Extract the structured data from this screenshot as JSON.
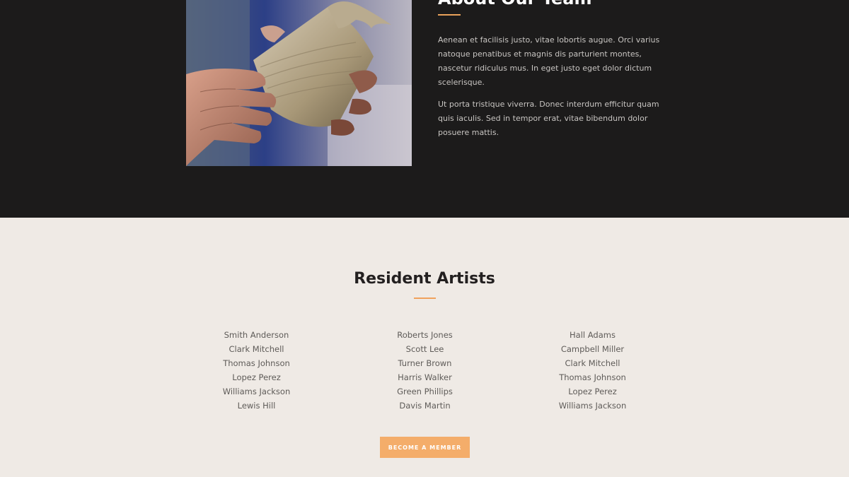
{
  "about": {
    "heading": "About Our Team",
    "paragraph_1": "Aenean et facilisis justo, vitae lobortis augue. Orci varius natoque penatibus et magnis dis parturient montes, nascetur ridiculus mus. In eget justo eget dolor dictum scelerisque.",
    "paragraph_2": "Ut porta tristique viverra. Donec interdum efficitur quam quis iaculis. Sed in tempor erat, vitae bibendum dolor posuere mattis.",
    "accent_color": "#e8a15a"
  },
  "artists": {
    "title": "Resident Artists",
    "columns": [
      [
        "Smith Anderson",
        "Clark Mitchell",
        "Thomas Johnson",
        "Lopez Perez",
        "Williams Jackson",
        "Lewis Hill"
      ],
      [
        "Roberts Jones",
        "Scott Lee",
        "Turner Brown",
        "Harris Walker",
        "Green Phillips",
        "Davis Martin"
      ],
      [
        "Hall Adams",
        "Campbell Miller",
        "Clark Mitchell",
        "Thomas Johnson",
        "Lopez Perez",
        "Williams Jackson"
      ]
    ],
    "cta_label": "Become a Member",
    "cta_color": "#f4ad6a"
  }
}
